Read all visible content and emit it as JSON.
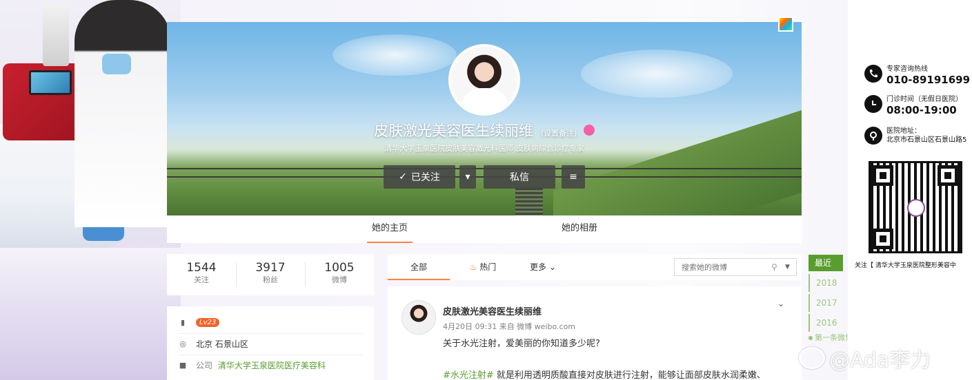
{
  "profile": {
    "name": "皮肤激光美容医生续丽维",
    "remark_link": "(设置备注)",
    "description": "清华大学玉泉医院皮肤美容激光科医师 皮肤病综合诊疗专家",
    "follow_label": "已关注",
    "message_label": "私信"
  },
  "tabs": {
    "home": "她的主页",
    "album": "她的相册"
  },
  "stats": {
    "following": "1544",
    "following_label": "关注",
    "fans": "3917",
    "fans_label": "粉丝",
    "posts": "1005",
    "posts_label": "微博"
  },
  "info": {
    "level": "Lv23",
    "location": "北京 石景山区",
    "company_prefix": "公司",
    "company": "清华大学玉泉医院医疗美容科"
  },
  "feed": {
    "tab_all": "全部",
    "tab_hot": "热门",
    "tab_more": "更多",
    "search_placeholder": "搜索她的微博"
  },
  "post": {
    "author": "皮肤激光美容医生续丽维",
    "meta": "4月20日 09:31 来自 微博 weibo.com",
    "text": "关于水光注射，爱美丽的你知道多少呢?",
    "tag": "#水光注射#",
    "text2": " 就是利用透明质酸直接对皮肤进行注射，能够让面部皮肤水润柔嫩、"
  },
  "timeline": {
    "recent": "最近",
    "years": [
      "2018",
      "2017",
      "2016"
    ],
    "first": "第一条微博"
  },
  "ad": {
    "hotline_label": "专家咨询热线",
    "hotline": "010-89191699",
    "hours_label": "门诊时间（无假日医院）",
    "hours": "08:00-19:00",
    "address_label": "医院地址：",
    "address": "北京市石景山区石景山路5",
    "follow_text": "关注【 清华大学玉泉医院整形美容中"
  },
  "watermark": "@Ada李力",
  "colors": {
    "accent_orange": "#ff8140",
    "link_green": "#5a9d2f",
    "timeline_green": "#9ec57c"
  }
}
